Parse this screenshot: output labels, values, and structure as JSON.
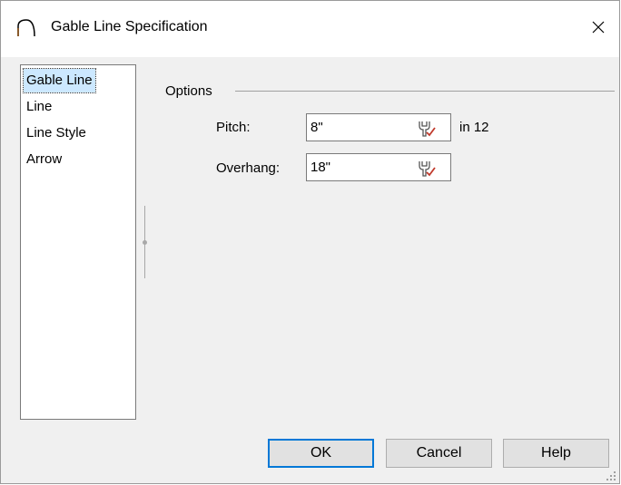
{
  "window": {
    "title": "Gable Line Specification",
    "title_icon": "gable-arc-icon",
    "close_icon": "close-icon"
  },
  "nav": {
    "items": [
      {
        "label": "Gable Line",
        "selected": true
      },
      {
        "label": "Line",
        "selected": false
      },
      {
        "label": "Line Style",
        "selected": false
      },
      {
        "label": "Arrow",
        "selected": false
      }
    ]
  },
  "options": {
    "group_label": "Options",
    "pitch": {
      "label": "Pitch:",
      "value": "8\"",
      "suffix": "in 12",
      "icon": "wrench-check-icon"
    },
    "overhang": {
      "label": "Overhang:",
      "value": "18\"",
      "icon": "wrench-check-icon"
    }
  },
  "buttons": {
    "ok": "OK",
    "cancel": "Cancel",
    "help": "Help"
  },
  "colors": {
    "accent": "#0078d7",
    "selection": "#cce8ff",
    "icon_red": "#c0392b"
  }
}
